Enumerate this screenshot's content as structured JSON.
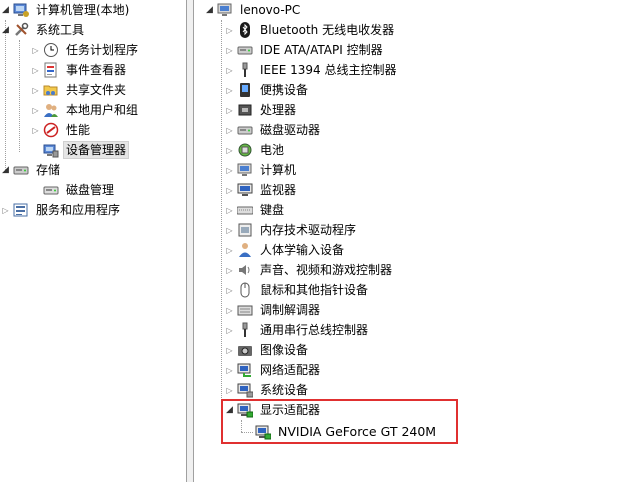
{
  "left_tree": {
    "root": "计算机管理(本地)",
    "system_tools": "系统工具",
    "task_scheduler": "任务计划程序",
    "event_viewer": "事件查看器",
    "shared_folders": "共享文件夹",
    "local_users": "本地用户和组",
    "performance": "性能",
    "device_manager": "设备管理器",
    "storage": "存储",
    "disk_management": "磁盘管理",
    "services": "服务和应用程序"
  },
  "device_tree": {
    "root": "lenovo-PC",
    "categories": [
      {
        "label": "Bluetooth 无线电收发器",
        "icon": "bluetooth-icon"
      },
      {
        "label": "IDE ATA/ATAPI 控制器",
        "icon": "ide-controller-icon"
      },
      {
        "label": "IEEE 1394 总线主控制器",
        "icon": "ieee1394-icon"
      },
      {
        "label": "便携设备",
        "icon": "portable-device-icon"
      },
      {
        "label": "处理器",
        "icon": "processor-icon"
      },
      {
        "label": "磁盘驱动器",
        "icon": "disk-drive-icon"
      },
      {
        "label": "电池",
        "icon": "battery-icon"
      },
      {
        "label": "计算机",
        "icon": "computer-icon"
      },
      {
        "label": "监视器",
        "icon": "monitor-icon"
      },
      {
        "label": "键盘",
        "icon": "keyboard-icon"
      },
      {
        "label": "内存技术驱动程序",
        "icon": "memory-tech-icon"
      },
      {
        "label": "人体学输入设备",
        "icon": "hid-icon"
      },
      {
        "label": "声音、视频和游戏控制器",
        "icon": "sound-icon"
      },
      {
        "label": "鼠标和其他指针设备",
        "icon": "mouse-icon"
      },
      {
        "label": "调制解调器",
        "icon": "modem-icon"
      },
      {
        "label": "通用串行总线控制器",
        "icon": "usb-icon"
      },
      {
        "label": "图像设备",
        "icon": "camera-icon"
      },
      {
        "label": "网络适配器",
        "icon": "network-adapter-icon"
      },
      {
        "label": "系统设备",
        "icon": "system-device-icon"
      },
      {
        "label": "显示适配器",
        "icon": "display-adapter-icon"
      }
    ],
    "display_child": "NVIDIA GeForce GT 240M"
  },
  "colors": {
    "highlight_box": "#e03030",
    "selected_bg": "#e5e5e5"
  }
}
